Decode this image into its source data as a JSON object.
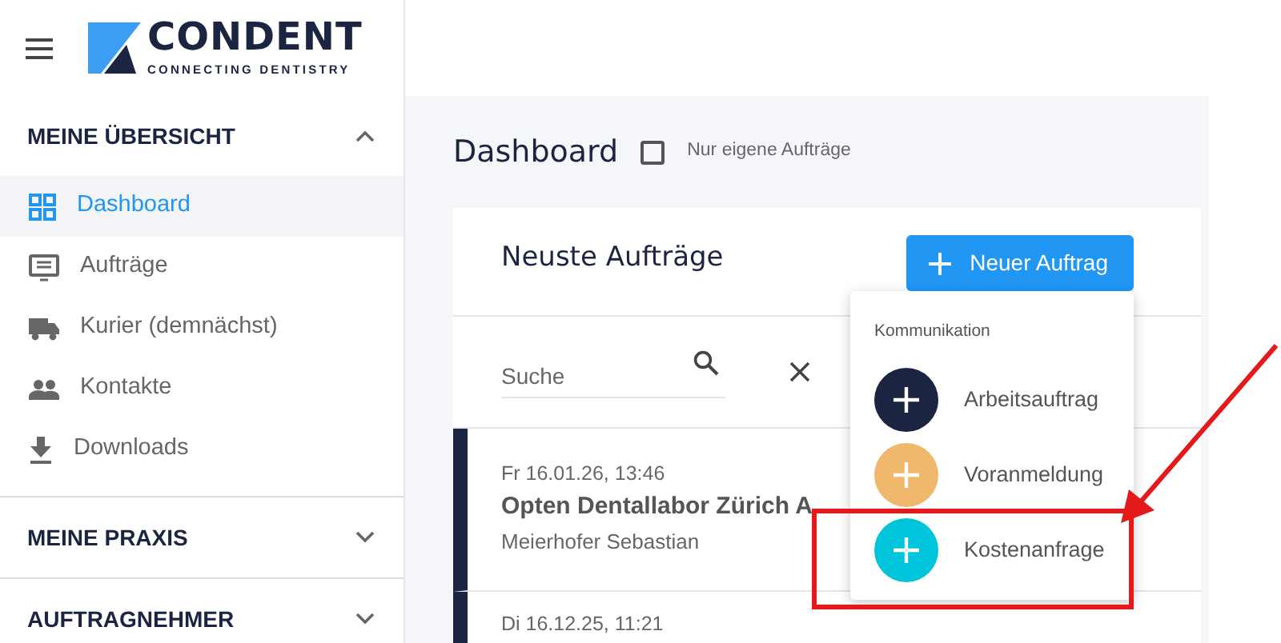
{
  "header": {
    "logo_title": "CONDENT",
    "logo_subtitle": "CONNECTING DENTISTRY"
  },
  "sidebar": {
    "sections": [
      {
        "title": "MEINE ÜBERSICHT",
        "expanded": true,
        "items": [
          {
            "label": "Dashboard",
            "kind": "grid",
            "selected": true
          },
          {
            "label": "Aufträge",
            "kind": "list",
            "selected": false
          },
          {
            "label": "Kurier (demnächst)",
            "kind": "truck",
            "selected": false
          },
          {
            "label": "Kontakte",
            "kind": "people",
            "selected": false
          },
          {
            "label": "Downloads",
            "kind": "download",
            "selected": false
          }
        ]
      },
      {
        "title": "MEINE PRAXIS",
        "expanded": false
      },
      {
        "title": "AUFTRAGNEHMER",
        "expanded": false
      }
    ]
  },
  "page": {
    "title": "Dashboard",
    "filter": {
      "label": "Nur eigene Aufträge",
      "checked": false
    }
  },
  "card": {
    "title": "Neuste Aufträge",
    "new_button": "Neuer Auftrag",
    "search": {
      "placeholder": "Suche"
    },
    "orders": [
      {
        "date": "Fr 16.01.26, 13:46",
        "lab": "Opten Dentallabor Zürich A",
        "person": "Meierhofer Sebastian"
      },
      {
        "date": "Di 16.12.25, 11:21"
      }
    ]
  },
  "menu": {
    "heading": "Kommunikation",
    "items": [
      {
        "label": "Arbeitsauftrag",
        "color": "#1b2541"
      },
      {
        "label": "Voranmeldung",
        "color": "#f0b86c"
      },
      {
        "label": "Kostenanfrage",
        "color": "#00c4d9"
      }
    ]
  }
}
